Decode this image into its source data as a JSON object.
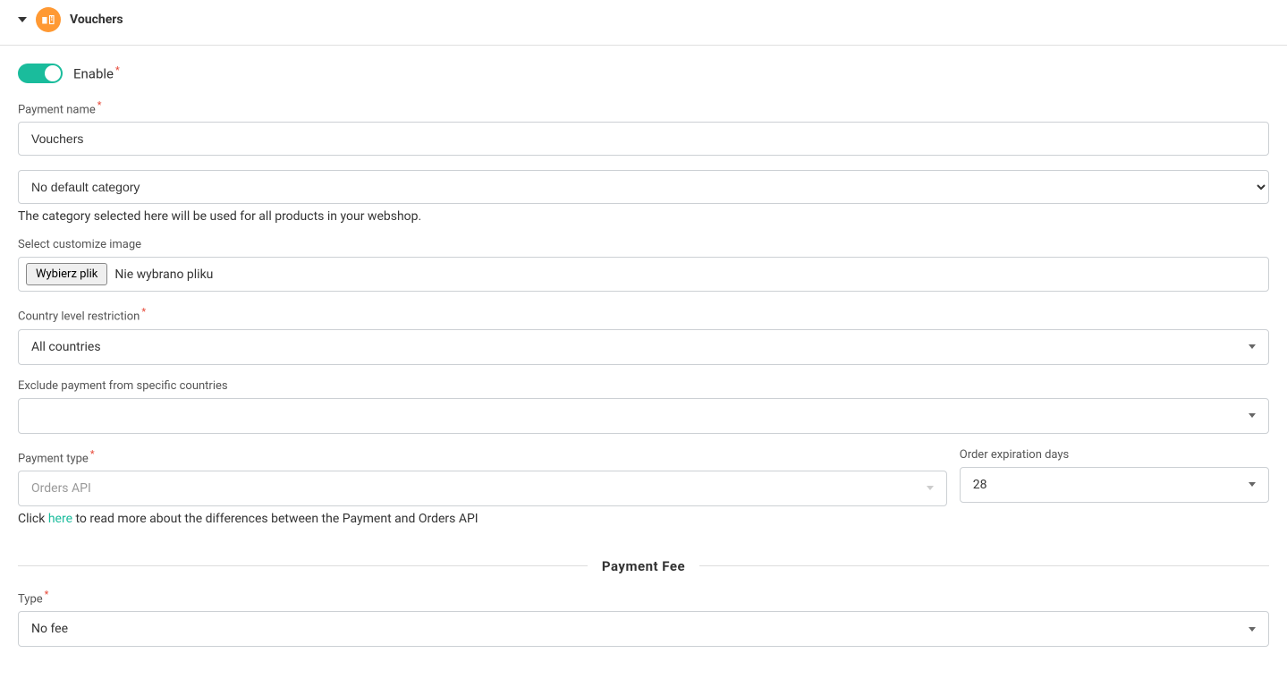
{
  "header": {
    "title": "Vouchers"
  },
  "enable": {
    "label": "Enable"
  },
  "paymentName": {
    "label": "Payment name",
    "value": "Vouchers"
  },
  "category": {
    "selected": "No default category",
    "help": "The category selected here will be used for all products in your webshop."
  },
  "customImage": {
    "label": "Select customize image",
    "buttonText": "Wybierz plik",
    "noFileText": "Nie wybrano pliku"
  },
  "countryRestriction": {
    "label": "Country level restriction",
    "value": "All countries"
  },
  "excludeCountries": {
    "label": "Exclude payment from specific countries",
    "value": ""
  },
  "paymentType": {
    "label": "Payment type",
    "value": "Orders API",
    "helpPrefix": "Click ",
    "helpLink": "here",
    "helpSuffix": " to read more about the differences between the Payment and Orders API"
  },
  "orderExpiration": {
    "label": "Order expiration days",
    "value": "28"
  },
  "paymentFee": {
    "sectionTitle": "Payment Fee",
    "typeLabel": "Type",
    "typeValue": "No fee"
  }
}
